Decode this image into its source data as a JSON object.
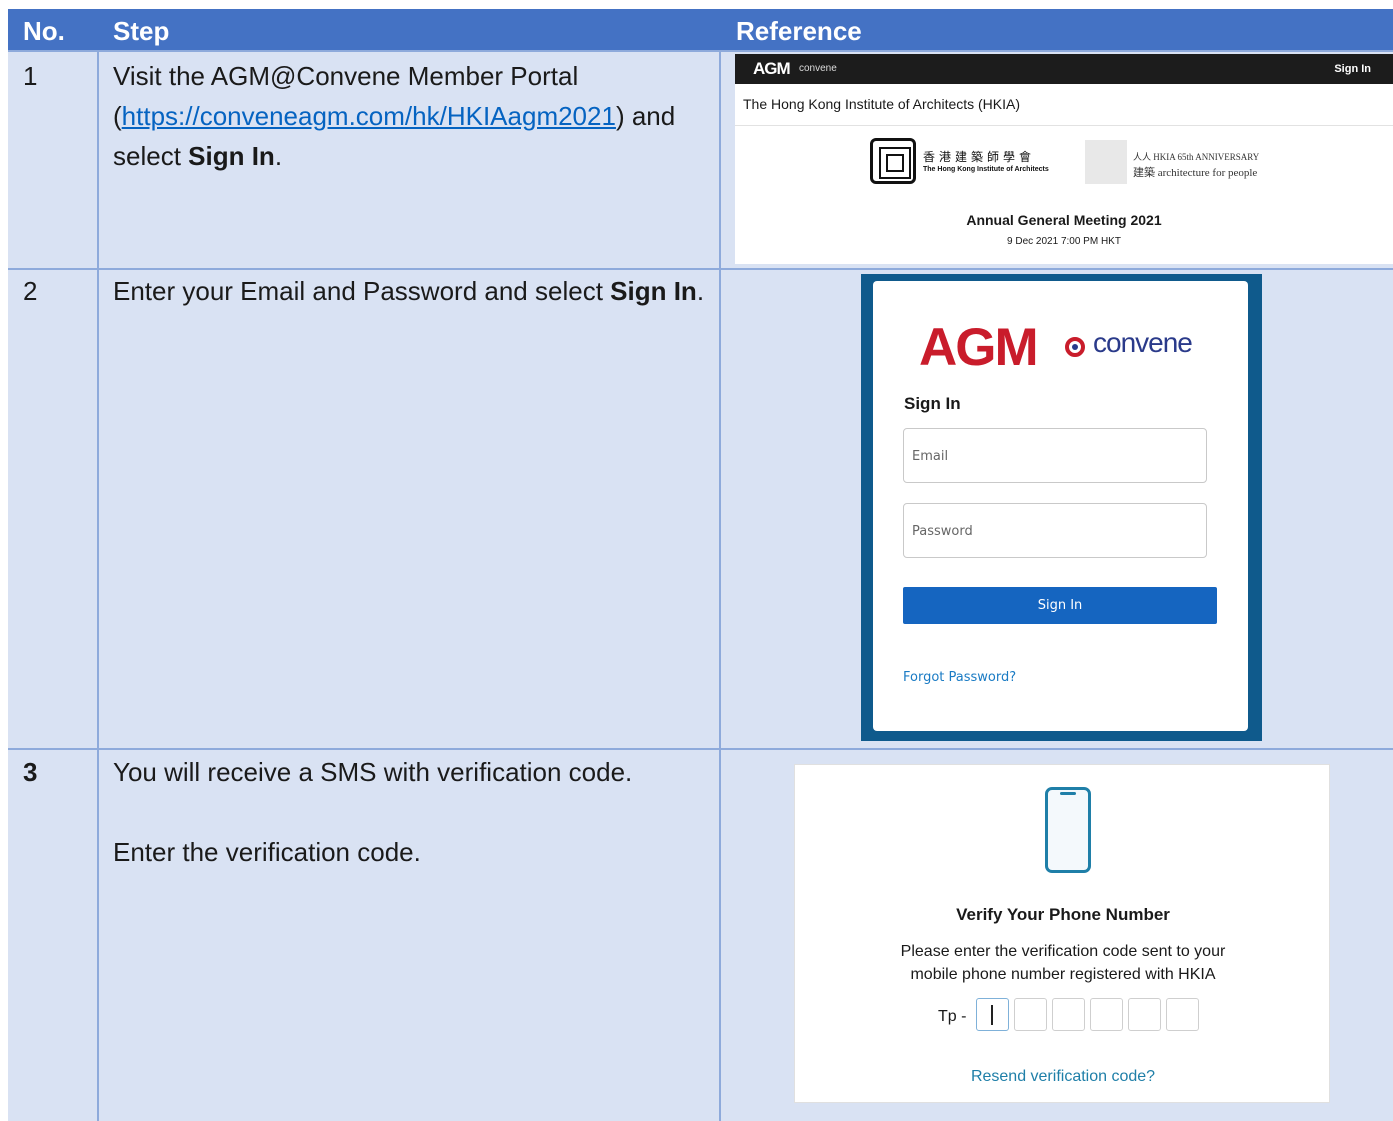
{
  "header": {
    "no": "No.",
    "step": "Step",
    "reference": "Reference"
  },
  "rows": [
    {
      "no": "1",
      "step_prefix": "Visit the AGM@Convene Member Portal (",
      "step_link": "https://conveneagm.com/hk/HKIAagm2021",
      "step_mid": ") and select ",
      "step_bold": "Sign In",
      "step_suffix": "."
    },
    {
      "no": "2",
      "step_prefix": "Enter your Email and Password and select ",
      "step_bold": "Sign In",
      "step_suffix": "."
    },
    {
      "no": "3",
      "step_line1": "You will receive a SMS with verification code.",
      "step_line2": "Enter the verification code."
    }
  ],
  "ref1": {
    "logo": "AGM",
    "logo_sub": "convene",
    "signin": "Sign In",
    "org": "The Hong Kong Institute of Architects (HKIA)",
    "org_cn": "香港建築師學會",
    "org_en": "The Hong Kong Institute of Architects",
    "anniv_line1": "人人 HKIA 65th ANNIVERSARY",
    "anniv_line2": "建築 architecture for people",
    "meeting": "Annual General Meeting 2021",
    "date": "9 Dec 2021 7:00 PM HKT"
  },
  "ref2": {
    "logo": "AGM",
    "logo_sub": "convene",
    "title": "Sign In",
    "email_placeholder": "Email",
    "password_placeholder": "Password",
    "button": "Sign In",
    "forgot": "Forgot Password?"
  },
  "ref3": {
    "title": "Verify Your Phone Number",
    "desc_line1": "Please enter the verification code sent to your",
    "desc_line2": "mobile phone number registered with HKIA",
    "prefix": "Tp -",
    "resend": "Resend verification code?"
  }
}
